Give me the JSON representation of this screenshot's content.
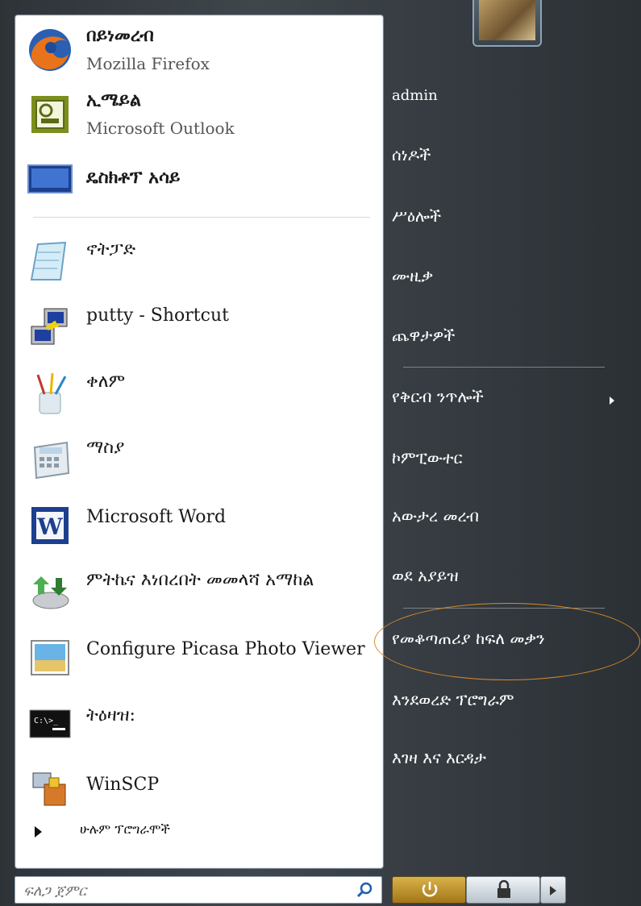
{
  "pinned": [
    {
      "title": "በይነመረብ",
      "subtitle": "Mozilla Firefox",
      "icon": "firefox-icon"
    },
    {
      "title": "ኢሜይል",
      "subtitle": "Microsoft Outlook",
      "icon": "outlook-icon"
    },
    {
      "title": "ዴስክቶፕ አሳይ",
      "subtitle": "",
      "icon": "desktop-icon"
    }
  ],
  "recent": [
    {
      "title": "ኖትፓድ",
      "icon": "notepad-icon"
    },
    {
      "title": "putty - Shortcut",
      "icon": "putty-icon"
    },
    {
      "title": "ቀለም",
      "icon": "paint-icon"
    },
    {
      "title": "ማስያ",
      "icon": "calculator-icon"
    },
    {
      "title": "Microsoft Word",
      "icon": "word-icon"
    },
    {
      "title": "ምትኬና እነበረበት መመላሻ አማከል",
      "icon": "backup-icon"
    },
    {
      "title": "Configure Picasa Photo Viewer",
      "icon": "picasa-icon"
    },
    {
      "title": "ትዕዛዝ:",
      "icon": "command-prompt-icon"
    },
    {
      "title": "WinSCP",
      "icon": "winscp-icon"
    }
  ],
  "all_programs": "ሁሉም ፕሮግራሞች",
  "search": {
    "placeholder": "ፍለጋ ጀምር"
  },
  "right_menu": {
    "user": "admin",
    "documents": "ሰነዶች",
    "pictures": "ሥዕሎች",
    "music": "ሙዚቃ",
    "games": "ጨዋታዎች",
    "recent_items": "የቅርብ ንጥሎች",
    "computer": "ኮምፒውተር",
    "network": "አውታረ መረብ",
    "connect_to": "ወደ አያይዝ",
    "control_panel": "የመቆጣጠሪያ ከፍለ መቃን",
    "default_programs": "እንደወረድ ፕሮግራም",
    "help": "እገዛ እና እርዳታ"
  },
  "colors": {
    "highlight": "#d88a2a",
    "accent": "#c89a2c"
  }
}
